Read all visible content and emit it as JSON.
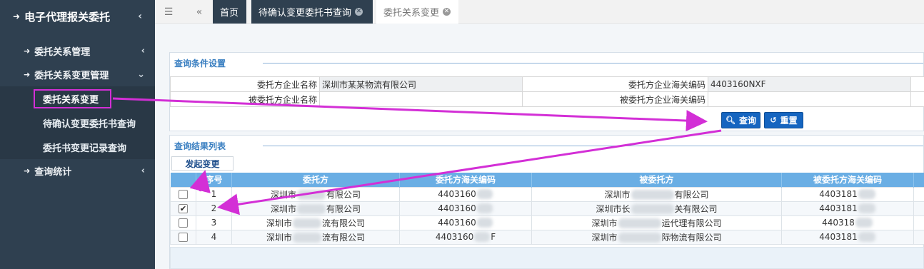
{
  "sidebar": {
    "title": "电子代理报关委托",
    "items": [
      {
        "label": "委托关系管理"
      },
      {
        "label": "委托关系变更管理"
      },
      {
        "label": "查询统计"
      }
    ],
    "subitems": [
      {
        "label": "委托关系变更"
      },
      {
        "label": "待确认变更委托书查询"
      },
      {
        "label": "委托书变更记录查询"
      }
    ]
  },
  "tabs": [
    {
      "label": "首页"
    },
    {
      "label": "待确认变更委托书查询"
    },
    {
      "label": "委托关系变更"
    }
  ],
  "query": {
    "title": "查询条件设置",
    "client_name_label": "委托方企业名称",
    "client_name_value": "深圳市某某物流有限公司",
    "client_code_label": "委托方企业海关编码",
    "client_code_value": "4403160NXF",
    "agent_name_label": "被委托方企业名称",
    "agent_code_label": "被委托方企业海关编码",
    "search_label": "查询",
    "reset_label": "重置"
  },
  "results": {
    "title": "查询结果列表",
    "start_change_label": "发起变更",
    "columns": [
      "序号",
      "委托方",
      "委托方海关编码",
      "被委托方",
      "被委托方海关编码"
    ],
    "rows": [
      {
        "no": "1",
        "client_pre": "深圳市",
        "client_post": "有限公司",
        "code_pre": "4403160",
        "code_post": "",
        "agent_pre": "深圳市",
        "agent_post": "有限公司",
        "agent_code_pre": "4403181",
        "checked": false
      },
      {
        "no": "2",
        "client_pre": "深圳市",
        "client_post": "有限公司",
        "code_pre": "4403160",
        "code_post": "",
        "agent_pre": "深圳市长",
        "agent_post": "关有限公司",
        "agent_code_pre": "4403181",
        "checked": true
      },
      {
        "no": "3",
        "client_pre": "深圳市",
        "client_post": "流有限公司",
        "code_pre": "4403160",
        "code_post": "",
        "agent_pre": "深圳市",
        "agent_post": "运代理有限公司",
        "agent_code_pre": "440318",
        "checked": false
      },
      {
        "no": "4",
        "client_pre": "深圳市",
        "client_post": "流有限公司",
        "code_pre": "4403160",
        "code_post": "F",
        "agent_pre": "深圳市",
        "agent_post": "际物流有限公司",
        "agent_code_pre": "4403181",
        "checked": false
      }
    ]
  },
  "colors": {
    "sidebar": "#2f4050",
    "accent": "#1565c0",
    "header": "#6aaee4",
    "annotation": "#d32fd6"
  }
}
